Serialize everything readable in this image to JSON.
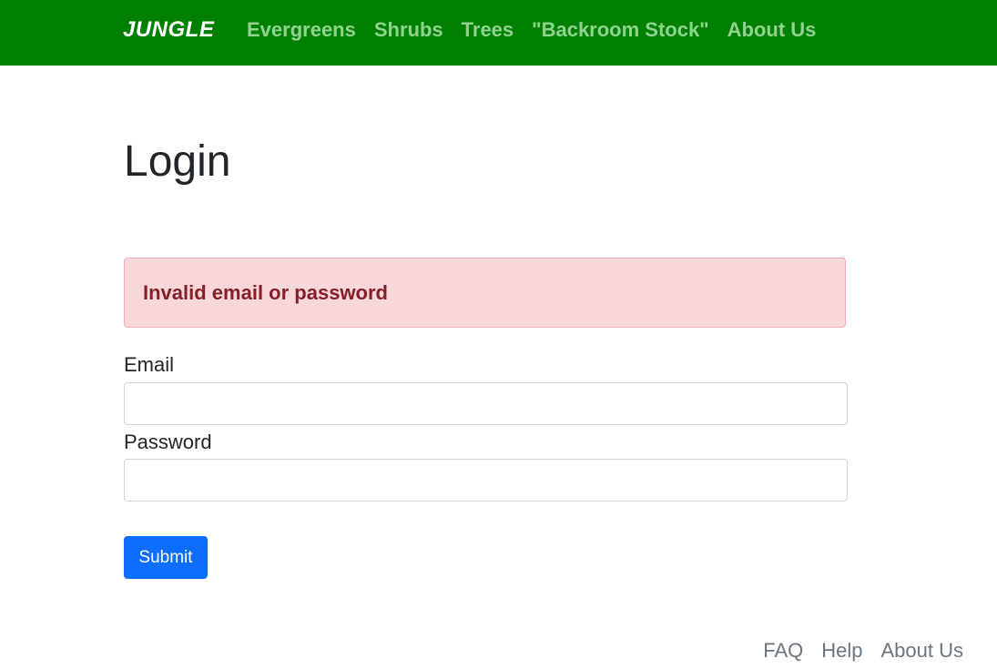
{
  "navbar": {
    "brand": "JUNGLE",
    "links": [
      "Evergreens",
      "Shrubs",
      "Trees",
      "\"Backroom Stock\"",
      "About Us"
    ]
  },
  "page": {
    "title": "Login"
  },
  "alert": {
    "message": "Invalid email or password"
  },
  "form": {
    "email_label": "Email",
    "email_value": "",
    "password_label": "Password",
    "password_value": "",
    "submit_label": "Submit"
  },
  "footer": {
    "links": [
      "FAQ",
      "Help",
      "About Us"
    ]
  },
  "colors": {
    "navbar_bg": "#008000",
    "nav_link": "#8fd38f",
    "alert_bg": "#f8d7da",
    "alert_text": "#842029",
    "primary": "#0d6efd",
    "footer_link": "#6c757d"
  }
}
